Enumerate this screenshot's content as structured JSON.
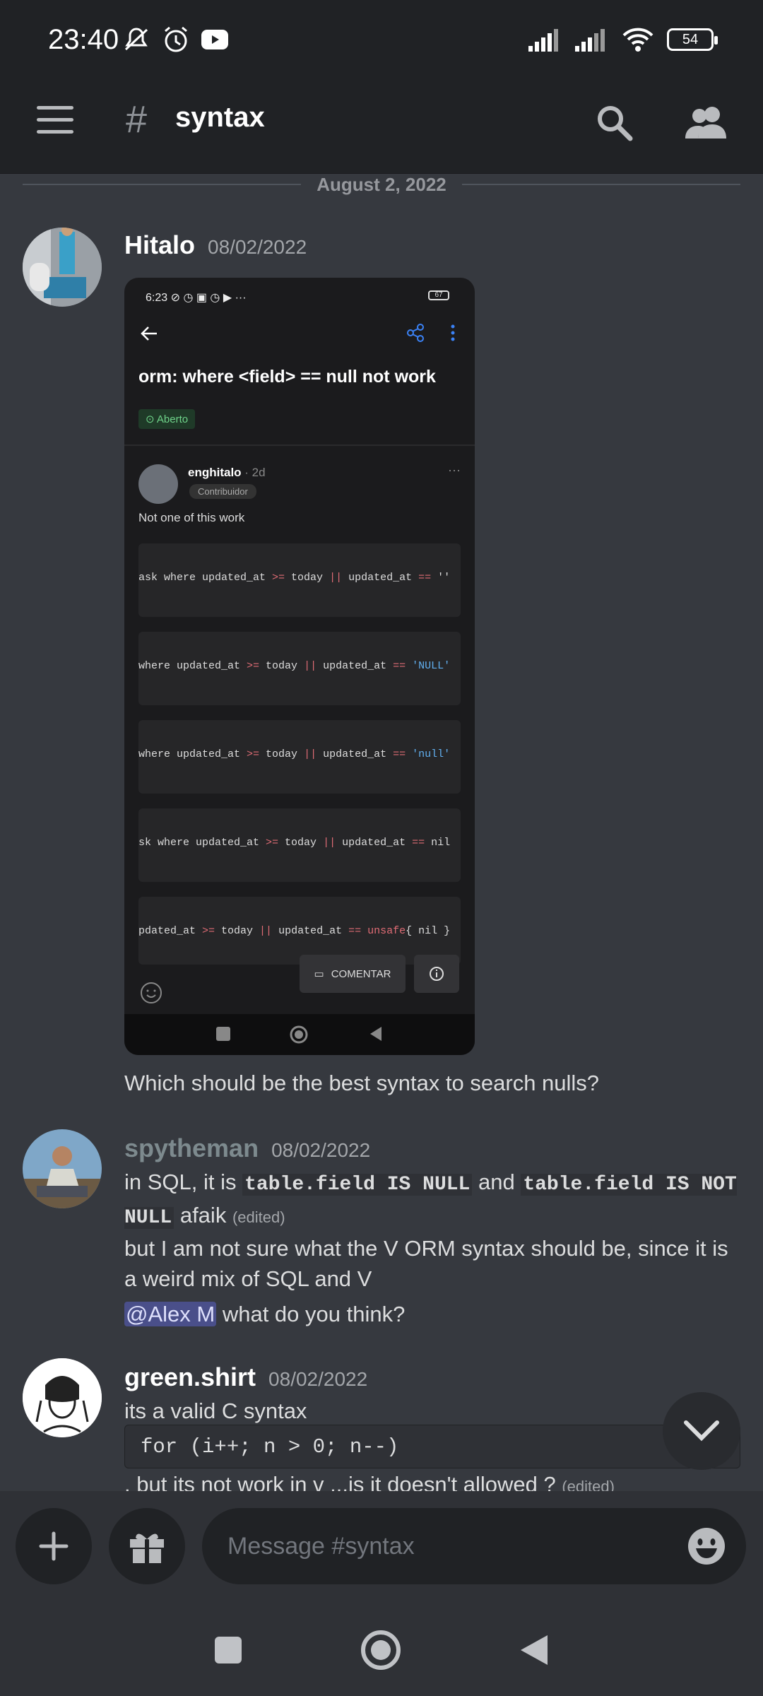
{
  "status_bar": {
    "time": "23:40",
    "battery": "54"
  },
  "toolbar": {
    "hash": "#",
    "channel": "syntax"
  },
  "date_separator": "August 2, 2022",
  "messages": [
    {
      "author": "Hitalo",
      "timestamp": "08/02/2022",
      "text": "Which should be the best syntax to search nulls?"
    },
    {
      "author": "spytheman",
      "timestamp": "08/02/2022",
      "line1_a": "in SQL, it is ",
      "code1": "table.field IS NULL",
      "line1_b": " and ",
      "code2": "table.field IS NOT NULL",
      "line1_c": " afaik ",
      "edited": "(edited)",
      "line2": "but I am not sure what the V ORM syntax should be, since it is a weird mix of SQL and V",
      "mention": "@Alex M",
      "line3": " what do you think?"
    },
    {
      "author": "green.shirt",
      "timestamp": "08/02/2022",
      "line1": "its  a valid C syntax",
      "code": "for (i++; n > 0; n--)",
      "line2": ". but its not work in v ...is it doesn't allowed ? ",
      "edited": "(edited)"
    }
  ],
  "embedded_screenshot": {
    "status_time": "6:23",
    "status_battery": "67",
    "title": "orm: where <field> == null not work",
    "badge": "Aberto",
    "user": "enghitalo",
    "age": " · 2d",
    "role": "Contribuidor",
    "body": "Not one of this work",
    "code_lines": [
      [
        "ask where updated_at ",
        ">=",
        " today ",
        "||",
        " updated_at ",
        "==",
        " ''"
      ],
      [
        "where updated_at ",
        ">=",
        " today ",
        "||",
        " updated_at ",
        "==",
        " 'NULL'"
      ],
      [
        "where updated_at ",
        ">=",
        " today ",
        "||",
        " updated_at ",
        "==",
        " 'null'"
      ],
      [
        "sk where updated_at ",
        ">=",
        " today ",
        "||",
        " updated_at ",
        "==",
        " nil"
      ],
      [
        "pdated_at ",
        ">=",
        " today ",
        "||",
        " updated_at ",
        "==",
        " unsafe",
        "{ nil }"
      ]
    ],
    "comment_button": "COMENTAR"
  },
  "composer": {
    "placeholder": "Message #syntax"
  },
  "colors": {
    "background": "#36393f",
    "bars": "#202225",
    "mention": "#4a4f8a"
  }
}
